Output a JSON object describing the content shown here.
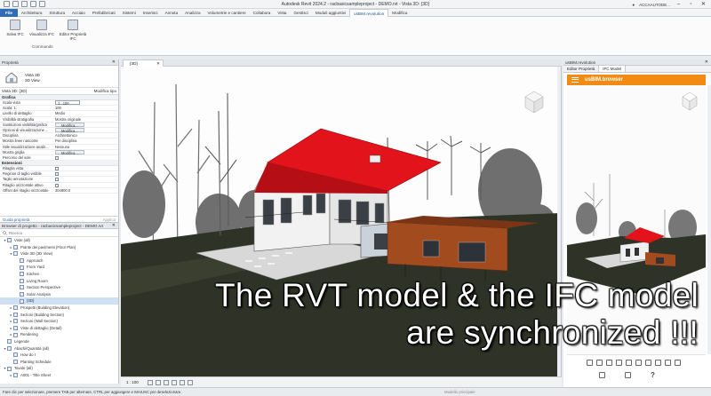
{
  "window": {
    "title": "Autodesk Revit 2024.2 - racbasicsampleproject - DEMO.rvt - Vista 3D: {3D}",
    "user": "ACCAAUTODE..."
  },
  "ribbon_tabs": [
    "File",
    "Architettura",
    "Struttura",
    "Acciaio",
    "Prefabbricati",
    "Sistemi",
    "Inserisci",
    "Annota",
    "Analizza",
    "Volumetrie e cantiere",
    "Collabora",
    "Vista",
    "Gestisci",
    "Moduli aggiuntivi",
    "usBIM.revolution",
    "Modifica"
  ],
  "active_tab": "usBIM.revolution",
  "ribbon": {
    "buttons": [
      "Salva IFC",
      "Visualizza IFC",
      "Editor Proprietà IFC"
    ],
    "group_label": "Commands"
  },
  "properties": {
    "title": "Proprietà",
    "type_name": "Vista 3D",
    "type_sub": "3D View",
    "selector": "Vista 3D: {3D}",
    "edit_type": "Modifica tipo",
    "sections": [
      {
        "name": "Grafica",
        "rows": [
          {
            "k": "Scala vista",
            "v": "1 : 100",
            "kind": "box"
          },
          {
            "k": "Scala: 1:",
            "v": "100",
            "kind": "text"
          },
          {
            "k": "Livello di dettaglio",
            "v": "Medio",
            "kind": "text"
          },
          {
            "k": "Visibilità stratigrafia",
            "v": "Mostra originale",
            "kind": "text"
          },
          {
            "k": "Sostituzioni visibilità/grafica",
            "v": "Modifica...",
            "kind": "btn"
          },
          {
            "k": "Opzioni di visualizzazione ...",
            "v": "Modifica...",
            "kind": "btn"
          },
          {
            "k": "Disciplina",
            "v": "Architettonico",
            "kind": "text"
          },
          {
            "k": "Mostra linee nascoste",
            "v": "Per disciplina",
            "kind": "text"
          },
          {
            "k": "Stile visualizzazione analiz...",
            "v": "Nessuno",
            "kind": "text"
          },
          {
            "k": "Mostra griglia",
            "v": "Modifica...",
            "kind": "btn"
          },
          {
            "k": "Percorso del sole",
            "v": "",
            "kind": "chk"
          }
        ]
      },
      {
        "name": "Estensioni",
        "rows": [
          {
            "k": "Ritaglia vista",
            "v": "",
            "kind": "chk"
          },
          {
            "k": "Regione di taglio visibile",
            "v": "",
            "kind": "chk"
          },
          {
            "k": "Taglio annotazione",
            "v": "",
            "kind": "chk"
          },
          {
            "k": "Ritaglio orizzontale attivo",
            "v": "",
            "kind": "chk"
          },
          {
            "k": "Offset del ritaglio orizzontale",
            "v": "304800.0",
            "kind": "text"
          }
        ]
      }
    ],
    "help_link": "Guida proprietà",
    "apply": "Applica"
  },
  "browser": {
    "title": "Browser di progetto - racbasicsampleproject - DEMO.rvt",
    "search_placeholder": "Ricerca",
    "items": [
      {
        "label": "Viste (all)",
        "level": 0,
        "toggle": "▾"
      },
      {
        "label": "Piante dei pavimenti (Floor Plan)",
        "level": 1,
        "toggle": "▸"
      },
      {
        "label": "Viste 3D (3D View)",
        "level": 1,
        "toggle": "▾"
      },
      {
        "label": "Approach",
        "level": 2,
        "toggle": ""
      },
      {
        "label": "From Yard",
        "level": 2,
        "toggle": ""
      },
      {
        "label": "Kitchen",
        "level": 2,
        "toggle": ""
      },
      {
        "label": "Living Room",
        "level": 2,
        "toggle": ""
      },
      {
        "label": "Section Perspective",
        "level": 2,
        "toggle": ""
      },
      {
        "label": "Solar Analysis",
        "level": 2,
        "toggle": ""
      },
      {
        "label": "{3D}",
        "level": 2,
        "toggle": "",
        "selected": true
      },
      {
        "label": "Prospetti (Building Elevation)",
        "level": 1,
        "toggle": "▸"
      },
      {
        "label": "Sezioni (Building Section)",
        "level": 1,
        "toggle": "▸"
      },
      {
        "label": "Sezioni (Wall Section)",
        "level": 1,
        "toggle": "▸"
      },
      {
        "label": "Viste di dettaglio (Detail)",
        "level": 1,
        "toggle": "▸"
      },
      {
        "label": "Rendering",
        "level": 1,
        "toggle": "▸"
      },
      {
        "label": "Legende",
        "level": 0,
        "toggle": ""
      },
      {
        "label": "Abachi/Quantità (all)",
        "level": 0,
        "toggle": "▾"
      },
      {
        "label": "How do I",
        "level": 1,
        "toggle": ""
      },
      {
        "label": "Planting Schedule",
        "level": 1,
        "toggle": ""
      },
      {
        "label": "Tavole (all)",
        "level": 0,
        "toggle": "▾"
      },
      {
        "label": "A001 - Title Sheet",
        "level": 1,
        "toggle": "▸"
      }
    ]
  },
  "view_tab": "{3D}",
  "view_scale": "1 : 100",
  "status": {
    "text": "Fare clic per selezionare, premere TAB per alternare, CTRL per aggiungere e MAIUSC per deselezionare.",
    "mid": "Modello principale"
  },
  "right_panel": {
    "title": "usBIM.revolution",
    "tabs": [
      "Editor Proprietà",
      "IFC Model"
    ],
    "browser_label": "usBIM.browser",
    "help": "?"
  },
  "caption": {
    "line1": "The RVT model & the IFC model",
    "line2": "are synchronized !!!"
  },
  "colors": {
    "roof": "#e2131a",
    "accent_orange": "#f28b13",
    "file_tab": "#2f6db5"
  }
}
